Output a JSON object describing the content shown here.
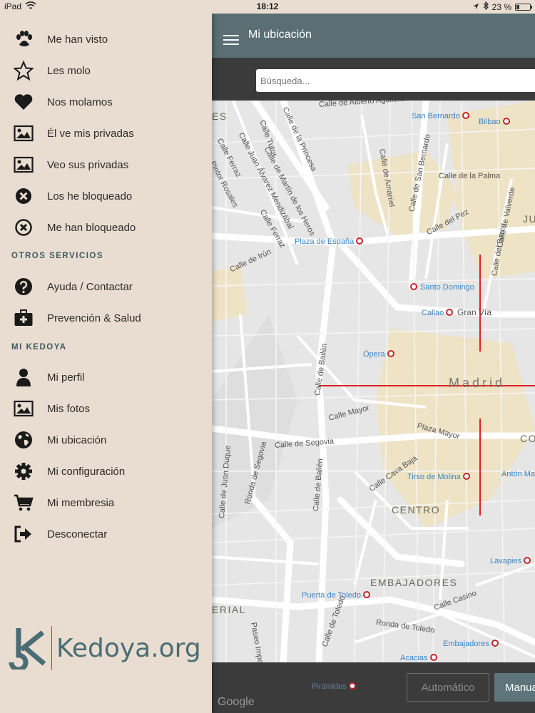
{
  "status_bar": {
    "carrier": "iPad",
    "time": "18:12",
    "battery": "23 %",
    "battery_level": 0.23
  },
  "app_bar": {
    "title": "Mi ubicación"
  },
  "search": {
    "placeholder": "Búsqueda..."
  },
  "drawer": {
    "items_top": [
      {
        "label": "Me han visto",
        "icon": "paw-icon"
      },
      {
        "label": "Les molo",
        "icon": "star-outline-icon"
      },
      {
        "label": "Nos molamos",
        "icon": "heart-icon"
      },
      {
        "label": "Él ve mis privadas",
        "icon": "image-icon"
      },
      {
        "label": "Veo sus privadas",
        "icon": "image-icon"
      },
      {
        "label": "Los he bloqueado",
        "icon": "block-circle-icon"
      },
      {
        "label": "Me han bloqueado",
        "icon": "block-circle-outline-icon"
      }
    ],
    "section_services": "OTROS SERVICIOS",
    "items_services": [
      {
        "label": "Ayuda / Contactar",
        "icon": "question-circle-icon"
      },
      {
        "label": "Prevención & Salud",
        "icon": "medkit-icon"
      }
    ],
    "section_account": "MI KEDOYA",
    "items_account": [
      {
        "label": "Mi perfil",
        "icon": "person-icon"
      },
      {
        "label": "Mis fotos",
        "icon": "image-icon"
      },
      {
        "label": "Mi ubicación",
        "icon": "globe-icon"
      },
      {
        "label": "Mi configuración",
        "icon": "gear-icon"
      },
      {
        "label": "Mi membresia",
        "icon": "cart-icon"
      },
      {
        "label": "Desconectar",
        "icon": "sign-out-icon"
      }
    ],
    "logo_text": "Kedoya.org"
  },
  "map": {
    "labels": {
      "calle_alberto_aguilera": "Calle de Alberto Aguilera",
      "san_bernardo_metro": "San Bernardo",
      "bilbao_metro": "Bilbao",
      "calle_tutor": "Calle Tutor",
      "calle_princesa": "Calle de la Princesa",
      "calle_martin_heros": "Calle de Martín de los Heros",
      "calle_juan_alvarez": "Calle Juan Álvarez Mendizábal",
      "calle_ferraz": "Calle Ferraz",
      "calle_pintor_rosales": "Pintor Rosales",
      "calle_amaniel": "Calle de Amaniel",
      "calle_palma": "Calle de la Palma",
      "calle_san_bernardo": "Calle de San Bernardo",
      "calle_pez": "Calle del Pez",
      "calle_barco": "Calle del Barco",
      "calle_valverde": "Calle de Valverde",
      "plaza_espana_metro": "Plaza de España",
      "calle_irun": "Calle de Irún",
      "santo_domingo_metro": "Santo Domingo",
      "callao_metro": "Callao",
      "gran_via": "Gran Vía",
      "opera_metro": "Ópera",
      "madrid": "Madrid",
      "calle_bailen": "Calle de Bailén",
      "calle_mayor": "Calle Mayor",
      "plaza_mayor": "Plaza Mayor",
      "calle_segovia": "Calle de Segovia",
      "calle_juan_duque": "Calle de Juan Duque",
      "ronda_segovia": "Ronda de Segovia",
      "calle_bailen_2": "Calle de Bailén",
      "calle_cava_baja": "Calle Cava Baja",
      "tirso_molina_metro": "Tirso de Molina",
      "anton_martin_metro": "Antón Mar",
      "centro": "CENTRO",
      "embajadores": "EMBAJADORES",
      "lavapies_metro": "Lavapies",
      "paseo_imperial": "Paseo Imperial",
      "puerta_toledo_metro": "Puerta de Toledo",
      "calle_casino": "Calle Casino",
      "ronda_toledo": "Ronda de Toledo",
      "calle_toledo": "Calle de Toledo",
      "embajadores_metro": "Embajadores",
      "acacias_metro": "Acacias",
      "piramides_metro": "Pirámides",
      "partial_es": "ES",
      "partial_ju": "JU",
      "partial_co": "CO",
      "partial_erial": "ERIAL",
      "google": "Google"
    }
  },
  "buttons": {
    "automatic": "Automático",
    "manual": "Manua"
  }
}
